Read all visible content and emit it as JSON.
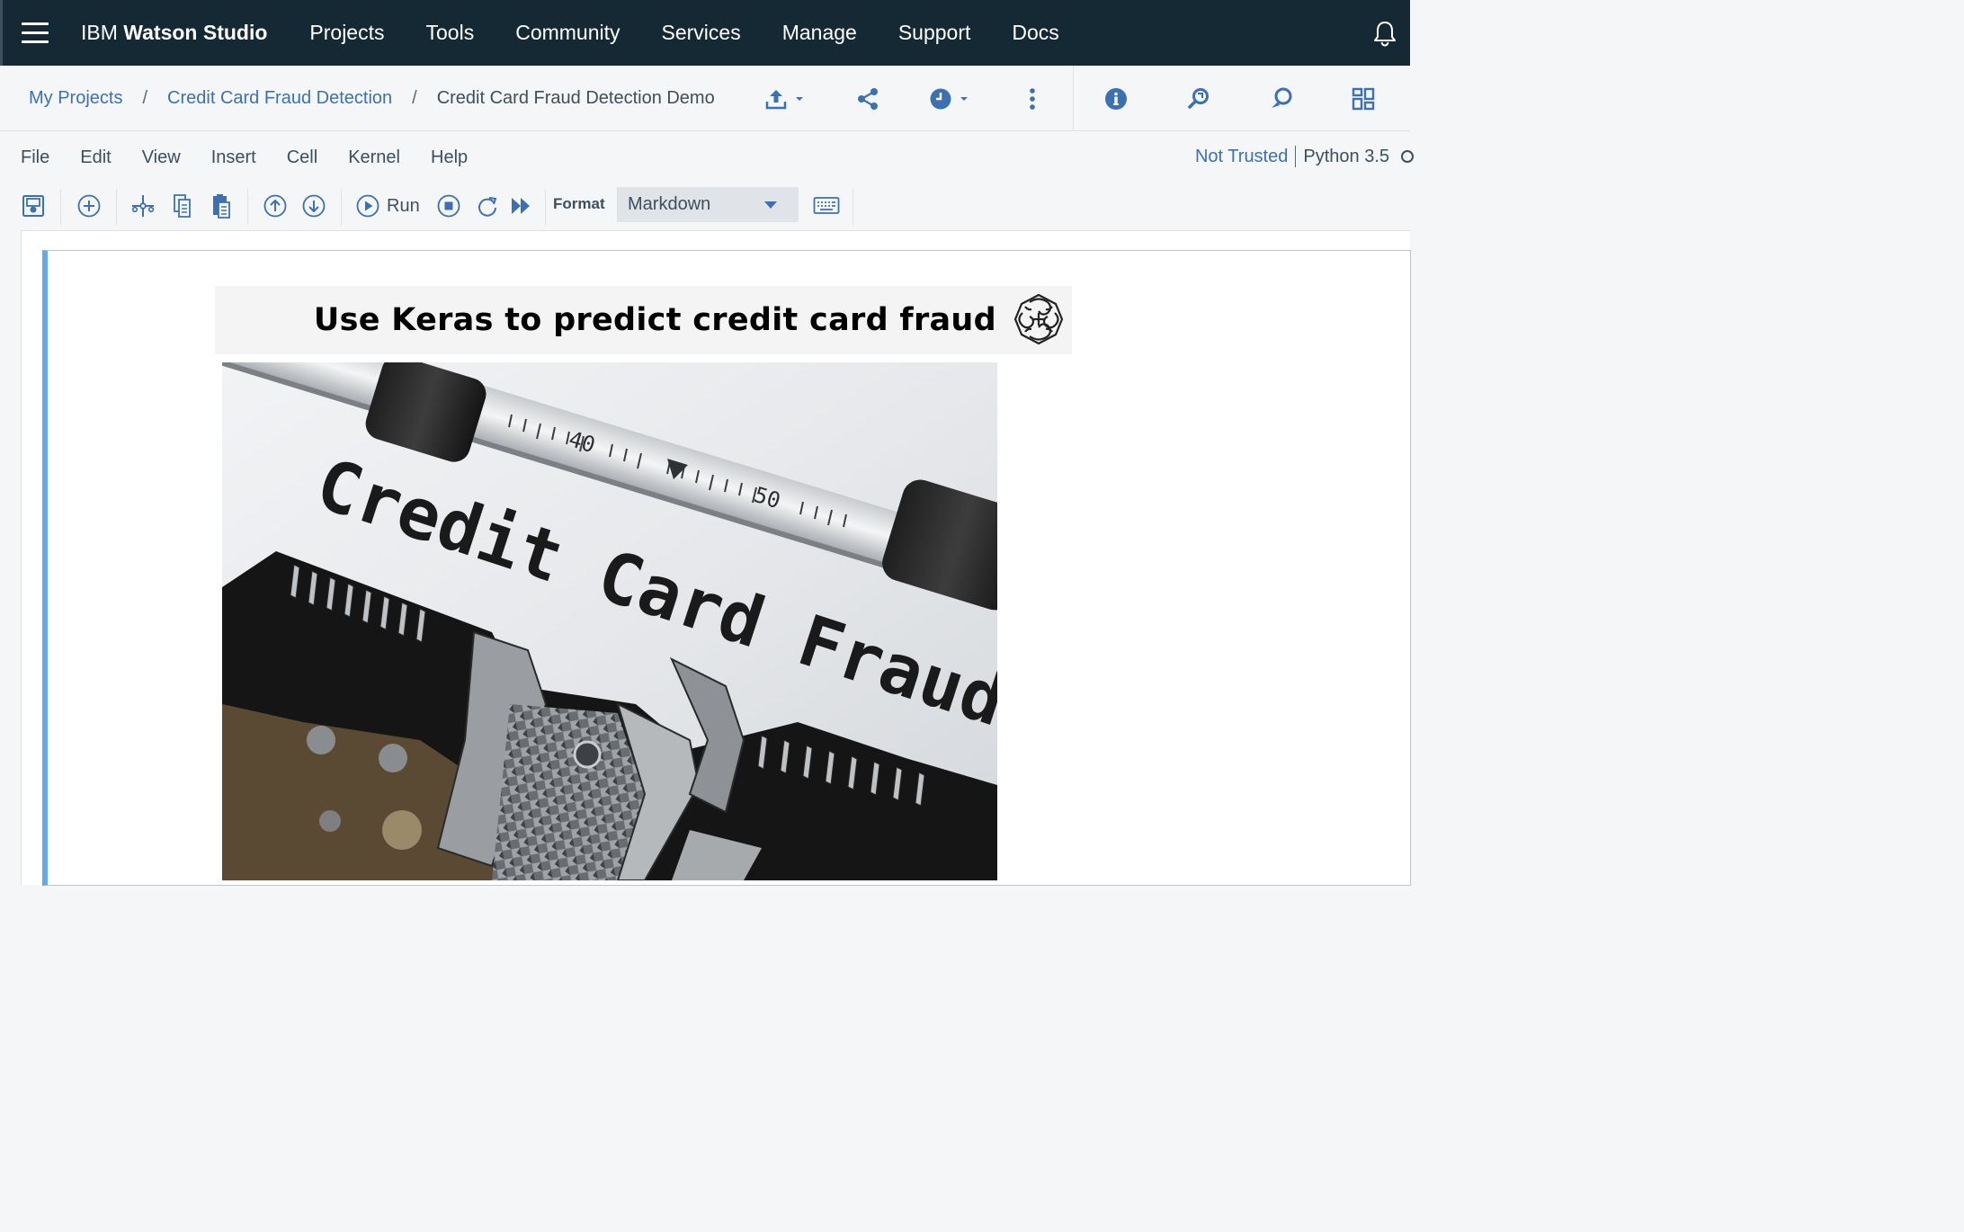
{
  "topnav": {
    "brand_prefix": "IBM",
    "brand_bold": "Watson Studio",
    "links": [
      "Projects",
      "Tools",
      "Community",
      "Services",
      "Manage",
      "Support",
      "Docs"
    ]
  },
  "breadcrumb": {
    "items": [
      "My Projects",
      "Credit Card Fraud Detection",
      "Credit Card Fraud Detection Demo"
    ],
    "separator": "/"
  },
  "menubar": {
    "items": [
      "File",
      "Edit",
      "View",
      "Insert",
      "Cell",
      "Kernel",
      "Help"
    ]
  },
  "kernel_status": {
    "trust": "Not Trusted",
    "kernel": "Python 3.5"
  },
  "toolbar": {
    "run_label": "Run",
    "format_label": "Format",
    "format_value": "Markdown"
  },
  "cell": {
    "title": "Use Keras to predict credit card fraud",
    "image": {
      "typed_text": "Credit Card Fraud",
      "ruler_marks": [
        "40",
        "50"
      ]
    }
  },
  "colors": {
    "nav_bg": "#152935",
    "link_blue": "#3d70b2",
    "cell_selected_border": "#66a9e8",
    "page_bg": "#f4f6f8"
  },
  "icons": [
    "menu-icon",
    "bell-icon",
    "upload-icon",
    "share-icon",
    "clock-icon",
    "more-vertical-icon",
    "info-icon",
    "find-replace-icon",
    "chat-icon",
    "data-panel-icon",
    "save-icon",
    "add-cell-icon",
    "cut-icon",
    "copy-icon",
    "paste-icon",
    "move-up-icon",
    "move-down-icon",
    "run-icon",
    "stop-icon",
    "restart-icon",
    "fast-forward-icon",
    "keyboard-icon",
    "brain-logo-icon"
  ]
}
